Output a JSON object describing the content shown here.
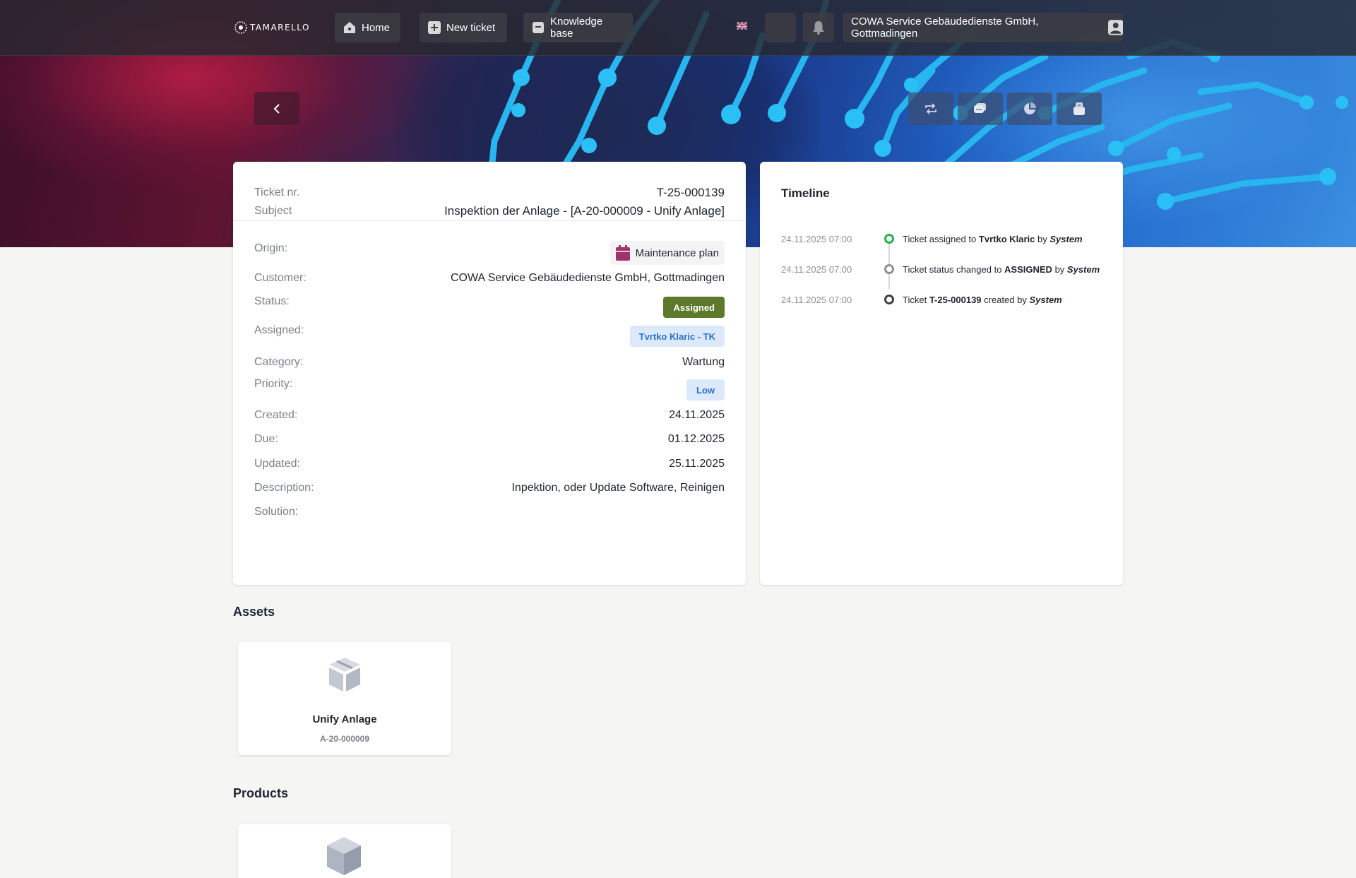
{
  "nav": {
    "logo_text": "TAMARELLO",
    "home": "Home",
    "new_ticket": "New ticket",
    "knowledge_base": "Knowledge base",
    "company": "COWA Service Gebäudedienste GmbH, Gottmadingen"
  },
  "ticket": {
    "nr_label": "Ticket nr.",
    "nr": "T-25-000139",
    "subject_label": "Subject",
    "subject": "Inspektion der Anlage - [A-20-000009 - Unify Anlage]",
    "origin_label": "Origin:",
    "origin": "Maintenance plan",
    "customer_label": "Customer:",
    "customer": "COWA Service Gebäudedienste GmbH, Gottmadingen",
    "status_label": "Status:",
    "status": "Assigned",
    "assigned_label": "Assigned:",
    "assigned": "Tvrtko Klaric - TK",
    "category_label": "Category:",
    "category": "Wartung",
    "priority_label": "Priority:",
    "priority": "Low",
    "created_label": "Created:",
    "created": "24.11.2025",
    "due_label": "Due:",
    "due": "01.12.2025",
    "updated_label": "Updated:",
    "updated": "25.11.2025",
    "description_label": "Description:",
    "description": "Inpektion, oder Update Software, Reinigen",
    "solution_label": "Solution:"
  },
  "timeline": {
    "title": "Timeline",
    "items": [
      {
        "time": "24.11.2025 07:00",
        "pre": "Ticket assigned to ",
        "bold": "Tvrtko Klaric",
        "mid": " by ",
        "actor": "System",
        "dot_color": "#22b04b"
      },
      {
        "time": "24.11.2025 07:00",
        "pre": "Ticket status changed to ",
        "bold": "ASSIGNED",
        "mid": " by ",
        "actor": "System",
        "dot_color": "#8a8f99"
      },
      {
        "time": "24.11.2025 07:00",
        "pre": "Ticket ",
        "bold": "T-25-000139",
        "mid": " created by ",
        "actor": "System",
        "dot_color": "#3a3f4a"
      }
    ]
  },
  "assets": {
    "title": "Assets",
    "items": [
      {
        "name": "Unify Anlage",
        "code": "A-20-000009"
      }
    ]
  },
  "products": {
    "title": "Products"
  },
  "colors": {
    "status_green": "#5c7a2a",
    "badge_blue_bg": "#dbe9fb",
    "badge_blue_text": "#2b6fc8",
    "origin_icon": "#a0336a"
  },
  "icons": {
    "home": "home-icon",
    "new_ticket": "plus-icon",
    "knowledge_base": "book-icon",
    "language": "uk-flag-icon",
    "theme": "moon-icon",
    "notifications": "bell-icon",
    "user": "user-icon",
    "back": "chevron-left-icon",
    "actions": [
      "repeat-icon",
      "comment-icon",
      "chart-icon",
      "archive-icon"
    ],
    "origin": "calendar-icon",
    "asset": "box-icon",
    "product": "cube-icon"
  }
}
